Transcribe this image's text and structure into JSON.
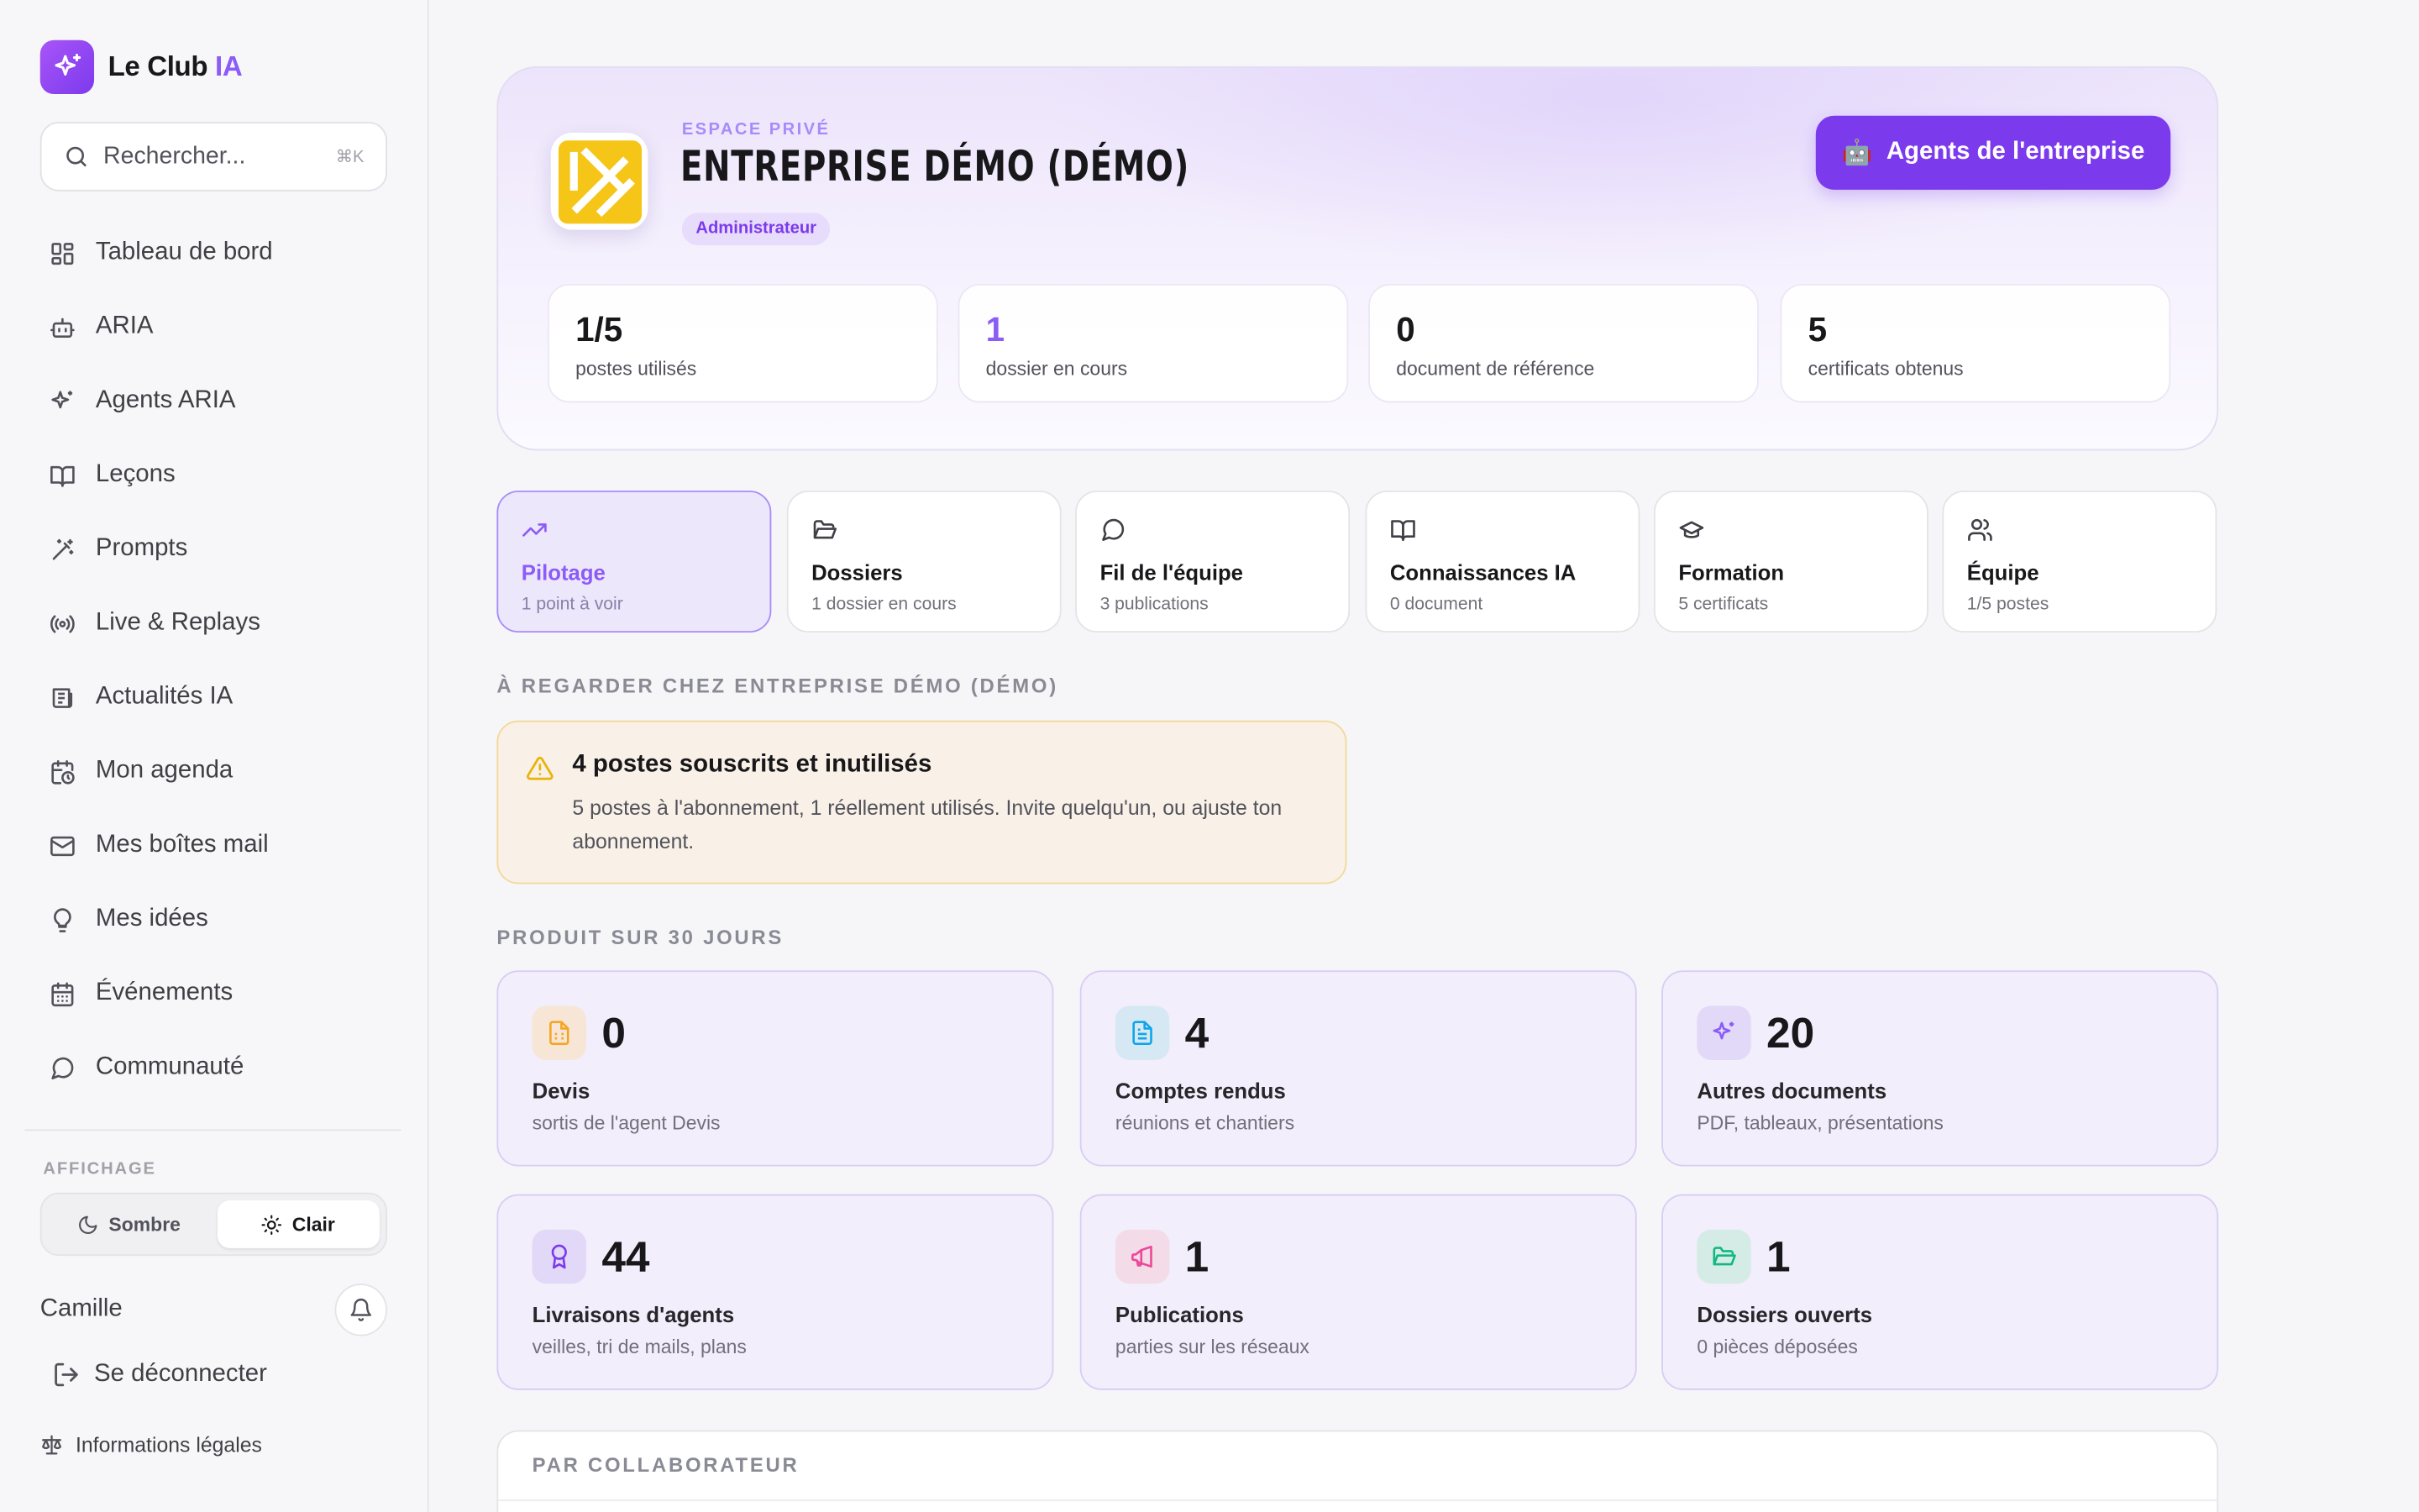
{
  "brand": {
    "name": "Le Club ",
    "accent": "IA"
  },
  "search": {
    "placeholder": "Rechercher...",
    "shortcut": "⌘K"
  },
  "nav": [
    {
      "label": "Tableau de bord",
      "icon": "dashboard-icon"
    },
    {
      "label": "ARIA",
      "icon": "bot-icon"
    },
    {
      "label": "Agents ARIA",
      "icon": "sparkles-icon"
    },
    {
      "label": "Leçons",
      "icon": "book-open-icon"
    },
    {
      "label": "Prompts",
      "icon": "wand-icon"
    },
    {
      "label": "Live & Replays",
      "icon": "broadcast-icon"
    },
    {
      "label": "Actualités IA",
      "icon": "newspaper-icon"
    },
    {
      "label": "Mon agenda",
      "icon": "calendar-clock-icon"
    },
    {
      "label": "Mes boîtes mail",
      "icon": "mail-icon"
    },
    {
      "label": "Mes idées",
      "icon": "lightbulb-icon"
    },
    {
      "label": "Événements",
      "icon": "calendar-icon"
    },
    {
      "label": "Communauté",
      "icon": "message-circle-icon"
    }
  ],
  "display": {
    "label": "AFFICHAGE",
    "dark": "Sombre",
    "light": "Clair",
    "active": "light"
  },
  "user": {
    "name": "Camille",
    "logout": "Se déconnecter",
    "legal": "Informations légales"
  },
  "hero": {
    "eyebrow": "ESPACE PRIVÉ",
    "title": "ENTREPRISE DÉMO (DÉMO)",
    "role": "Administrateur",
    "agents_button": "Agents de l'entreprise",
    "agents_emoji": "🤖"
  },
  "stats": [
    {
      "value": "1/5",
      "label": "postes utilisés"
    },
    {
      "value": "1",
      "label": "dossier en cours"
    },
    {
      "value": "0",
      "label": "document de référence"
    },
    {
      "value": "5",
      "label": "certificats obtenus"
    }
  ],
  "tabs": [
    {
      "title": "Pilotage",
      "sub": "1 point à voir",
      "icon": "trending-up-icon"
    },
    {
      "title": "Dossiers",
      "sub": "1 dossier en cours",
      "icon": "folder-open-icon"
    },
    {
      "title": "Fil de l'équipe",
      "sub": "3 publications",
      "icon": "message-circle-icon"
    },
    {
      "title": "Connaissances IA",
      "sub": "0 document",
      "icon": "book-open-icon"
    },
    {
      "title": "Formation",
      "sub": "5 certificats",
      "icon": "graduation-cap-icon"
    },
    {
      "title": "Équipe",
      "sub": "1/5 postes",
      "icon": "users-icon"
    }
  ],
  "watch_section": "À REGARDER CHEZ ENTREPRISE DÉMO (DÉMO)",
  "alert": {
    "title": "4 postes souscrits et inutilisés",
    "desc": "5 postes à l'abonnement, 1 réellement utilisés. Invite quelqu'un, ou ajuste ton abonnement."
  },
  "produced_section": "PRODUIT SUR 30 JOURS",
  "metrics": [
    {
      "value": "0",
      "title": "Devis",
      "sub": "sortis de l'agent Devis",
      "icon": "file-spreadsheet-icon",
      "color": "#f5a524",
      "bg": "#f7e6d6"
    },
    {
      "value": "4",
      "title": "Comptes rendus",
      "sub": "réunions et chantiers",
      "icon": "file-text-icon",
      "color": "#0ea5e9",
      "bg": "#d6e8f3"
    },
    {
      "value": "20",
      "title": "Autres documents",
      "sub": "PDF, tableaux, présentations",
      "icon": "sparkles-icon",
      "color": "#8b5cf6",
      "bg": "#e2d8f8"
    },
    {
      "value": "44",
      "title": "Livraisons d'agents",
      "sub": "veilles, tri de mails, plans",
      "icon": "award-icon",
      "color": "#7c3aed",
      "bg": "#e2d8f8"
    },
    {
      "value": "1",
      "title": "Publications",
      "sub": "parties sur les réseaux",
      "icon": "megaphone-icon",
      "color": "#ec4899",
      "bg": "#f3dbe7"
    },
    {
      "value": "1",
      "title": "Dossiers ouverts",
      "sub": "0 pièces déposées",
      "icon": "folder-open-icon",
      "color": "#10b981",
      "bg": "#d5ebe6"
    }
  ],
  "collab_section": "PAR COLLABORATEUR"
}
